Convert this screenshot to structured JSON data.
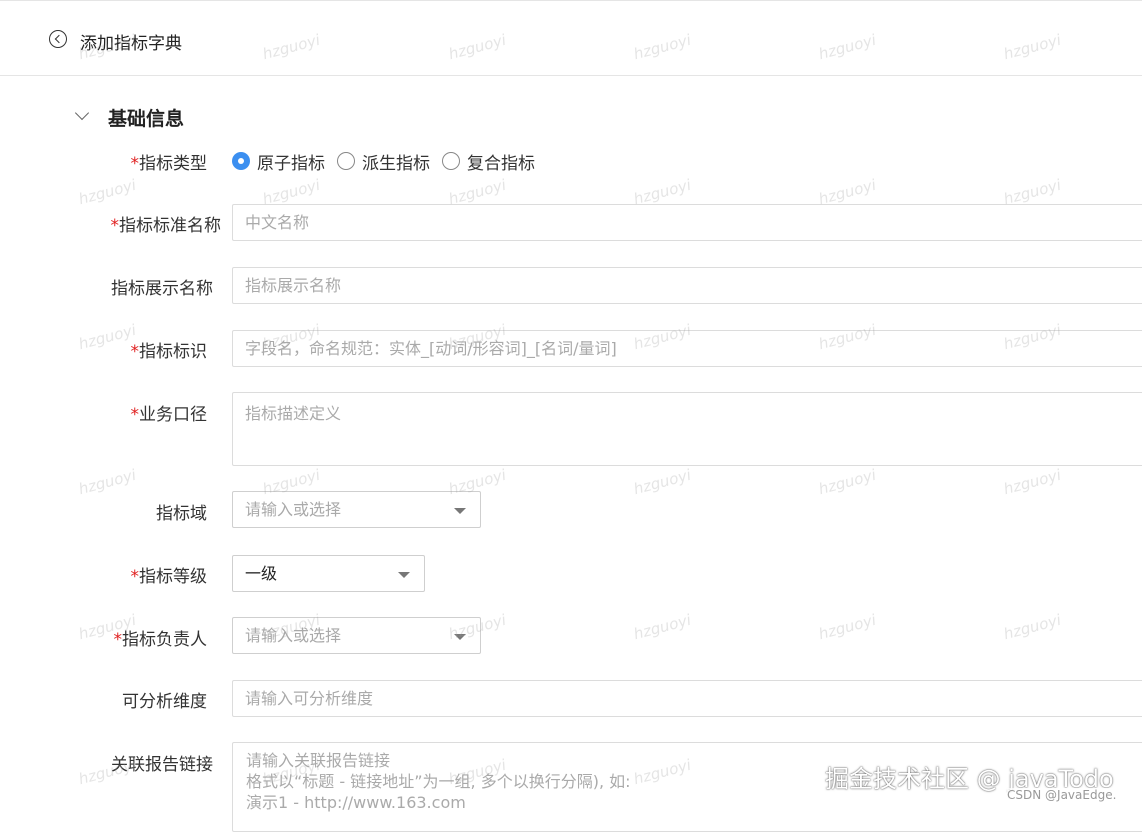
{
  "header": {
    "title": "添加指标字典"
  },
  "section": {
    "title": "基础信息"
  },
  "fields": {
    "type": {
      "label": "指标类型",
      "required": true
    },
    "standard_name": {
      "label": "指标标准名称",
      "required": true,
      "placeholder": "中文名称"
    },
    "display_name": {
      "label": "指标展示名称",
      "required": false,
      "placeholder": "指标展示名称"
    },
    "identifier": {
      "label": "指标标识",
      "required": true,
      "placeholder": "字段名，命名规范：实体_[动词/形容词]_[名词/量词]"
    },
    "business_caliber": {
      "label": "业务口径",
      "required": true,
      "placeholder": "指标描述定义"
    },
    "domain": {
      "label": "指标域",
      "required": false,
      "placeholder": "请输入或选择"
    },
    "level": {
      "label": "指标等级",
      "required": true,
      "value": "一级"
    },
    "owner": {
      "label": "指标负责人",
      "required": true,
      "placeholder": "请输入或选择"
    },
    "dimensions": {
      "label": "可分析维度",
      "required": false,
      "placeholder": "请输入可分析维度"
    },
    "report_links": {
      "label": "关联报告链接",
      "required": false,
      "placeholder_lines": [
        "请输入关联报告链接",
        "格式以“标题 - 链接地址”为一组, 多个以换行分隔), 如:",
        "演示1 - http://www.163.com"
      ]
    }
  },
  "radio_options": [
    "原子指标",
    "派生指标",
    "复合指标"
  ],
  "radio_selected": "原子指标",
  "required_mark": "*",
  "watermark_text": "hzguoyi",
  "credit": {
    "main": "掘金技术社区 @ javaTodo",
    "sub": "CSDN @JavaEdge."
  },
  "colors": {
    "accent": "#3b8ff0",
    "required": "#e02020",
    "border": "#dcdcdc"
  },
  "icons": {
    "back": "back-circle-icon",
    "collapse": "chevron-down-icon",
    "dropdown": "caret-down-icon"
  }
}
